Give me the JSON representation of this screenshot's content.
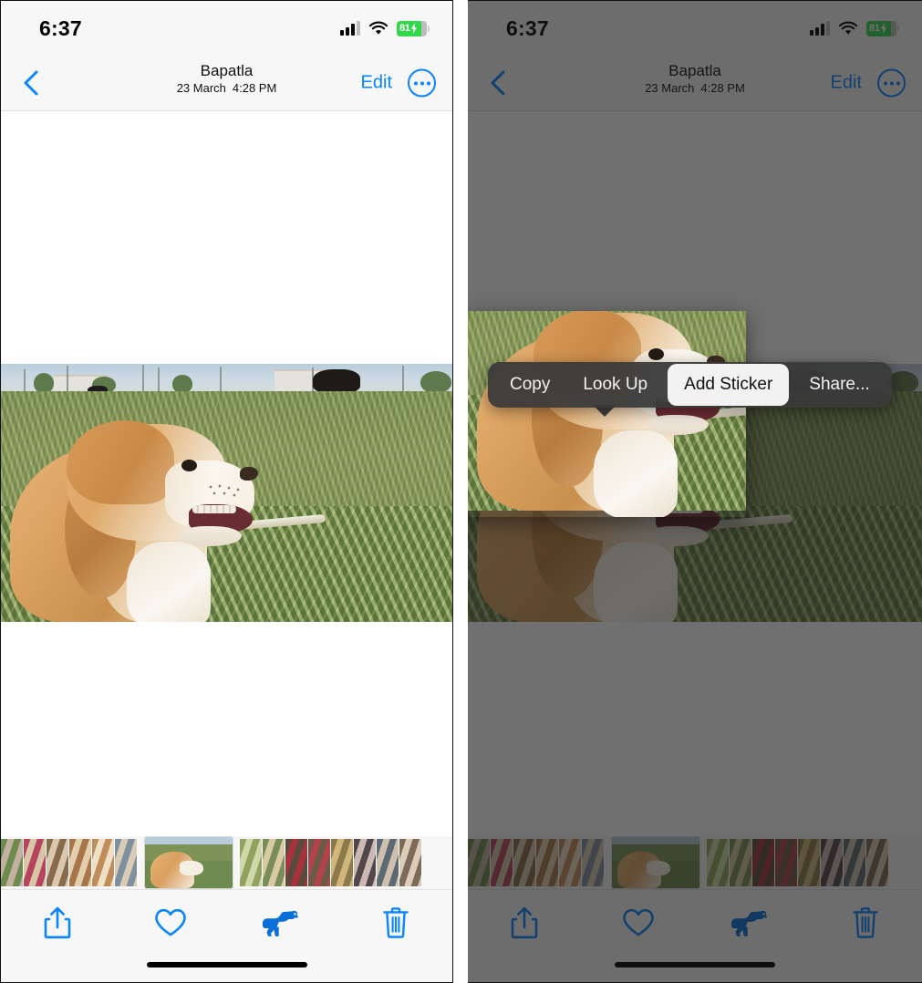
{
  "meta": {
    "app": "Photos",
    "platform": "iOS",
    "panels": 2,
    "accent_color": "#0a84ff",
    "battery_color": "#32d74b"
  },
  "status_bar": {
    "time": "6:37",
    "battery_percent": "81",
    "battery_charging": true,
    "icons": [
      "cellular-signal-icon",
      "wifi-icon",
      "battery-icon"
    ]
  },
  "nav_bar": {
    "back_label": "Back",
    "title": "Bapatla",
    "date": "23 March",
    "time": "4:28 PM",
    "edit_label": "Edit",
    "more_label": "More options"
  },
  "photo": {
    "description": "Tan and white dog in profile lying in a grassy field with a black cow grazing in the background",
    "alt": "Bapatla dog photo"
  },
  "context_menu": {
    "visible_on": "right-panel",
    "items": [
      {
        "label": "Copy",
        "active": false
      },
      {
        "label": "Look Up",
        "active": false
      },
      {
        "label": "Add Sticker",
        "active": true
      },
      {
        "label": "Share...",
        "active": false
      }
    ]
  },
  "toolbar": {
    "buttons": [
      {
        "name": "share-button",
        "icon": "share-icon",
        "label": "Share"
      },
      {
        "name": "favorite-button",
        "icon": "heart-icon",
        "label": "Favorite"
      },
      {
        "name": "pet-info-button",
        "icon": "dog-icon",
        "label": "Pet Info"
      },
      {
        "name": "delete-button",
        "icon": "trash-icon",
        "label": "Delete"
      }
    ]
  },
  "filmstrip": {
    "selected_index": 6,
    "thumbs": [
      {
        "c1": "#6f8a4e",
        "c2": "#c2b0a0"
      },
      {
        "c1": "#b6445e",
        "c2": "#d7c6a8"
      },
      {
        "c1": "#8a6a4c",
        "c2": "#d9c7ae"
      },
      {
        "c1": "#a9764a",
        "c2": "#e3cfae"
      },
      {
        "c1": "#c08d5a",
        "c2": "#efe0c8"
      },
      {
        "c1": "#7e8fa0",
        "c2": "#d9cbb4"
      },
      {
        "c1": "#5d90c4",
        "c2": "#e3d3bb"
      },
      {
        "c1": "#8fa35f",
        "c2": "#cfd9a8"
      },
      {
        "c1": "#7a8d56",
        "c2": "#d7c9a4"
      },
      {
        "c1": "#5a4a3c",
        "c2": "#a8323c"
      },
      {
        "c1": "#6b5a46",
        "c2": "#b2424c"
      },
      {
        "c1": "#8d7a4c",
        "c2": "#d2b579"
      },
      {
        "c1": "#52474a",
        "c2": "#cdb9b4"
      },
      {
        "c1": "#5e6a72",
        "c2": "#cfbfae"
      },
      {
        "c1": "#7d6a58",
        "c2": "#ddcdb8"
      }
    ]
  }
}
